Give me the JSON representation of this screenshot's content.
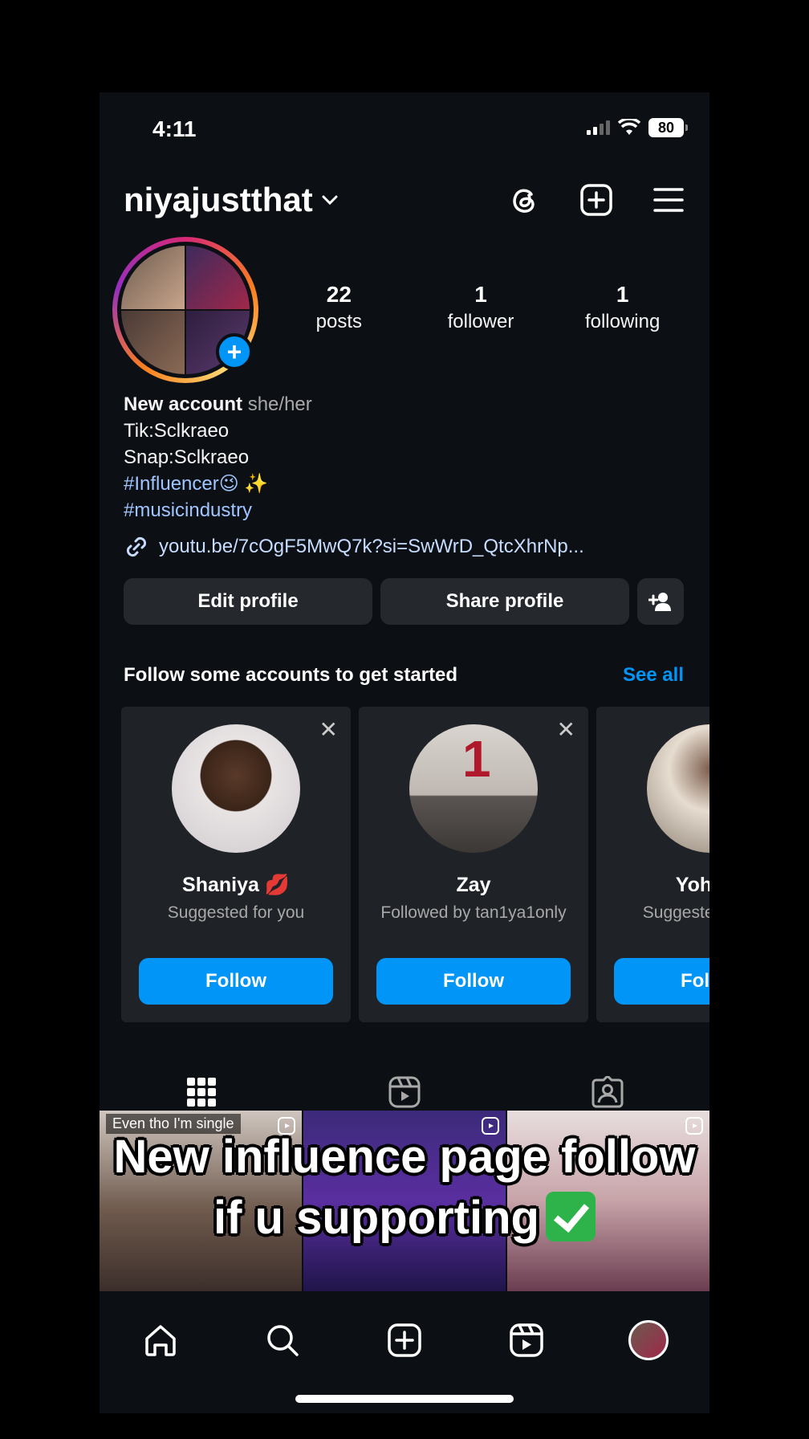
{
  "status_bar": {
    "time": "4:11",
    "battery": "80"
  },
  "header": {
    "username": "niyajustthat"
  },
  "profile": {
    "stats": [
      {
        "value": "22",
        "label": "posts"
      },
      {
        "value": "1",
        "label": "follower"
      },
      {
        "value": "1",
        "label": "following"
      }
    ],
    "name": "New account",
    "pronouns": "she/her",
    "bio_lines": [
      "Tik:Sclkraeo",
      "Snap:Sclkraeo"
    ],
    "hashtag_1": "#Influencer😉 ✨",
    "hashtag_2": "#musicindustry",
    "link": "youtu.be/7cOgF5MwQ7k?si=SwWrD_QtcXhrNp..."
  },
  "buttons": {
    "edit": "Edit profile",
    "share": "Share profile"
  },
  "suggestions": {
    "title": "Follow some accounts to get started",
    "see_all": "See all",
    "cards": [
      {
        "name": "Shaniya 💋",
        "subtitle": "Suggested for you",
        "follow": "Follow"
      },
      {
        "name": "Zay",
        "subtitle": "Followed by tan1ya1only",
        "follow": "Follow"
      },
      {
        "name": "Yohana",
        "subtitle": "Suggested for you",
        "follow": "Follow"
      }
    ]
  },
  "grid": {
    "tile_1_caption": "Even tho I'm single"
  },
  "overlay": {
    "line_1": "New influence page follow",
    "line_2": "if u supporting"
  }
}
